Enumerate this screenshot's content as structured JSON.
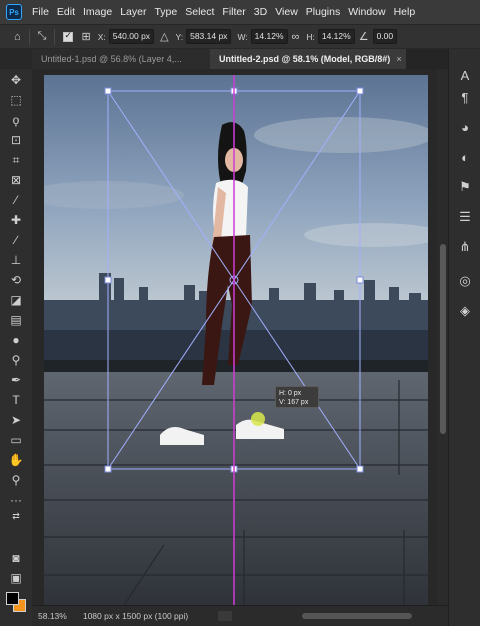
{
  "menu": {
    "logo": "Ps",
    "items": [
      "File",
      "Edit",
      "Image",
      "Layer",
      "Type",
      "Select",
      "Filter",
      "3D",
      "View",
      "Plugins",
      "Window",
      "Help"
    ]
  },
  "options": {
    "x_label": "X:",
    "x_value": "540.00 px",
    "y_label": "Y:",
    "y_value": "583.14 px",
    "w_label": "W:",
    "w_value": "14.12%",
    "h_label": "H:",
    "h_value": "14.12%",
    "angle_value": "0.00"
  },
  "tabs": [
    {
      "label": "Untitled-1.psd @ 56.8% (Layer 4,...",
      "active": false
    },
    {
      "label": "Untitled-2.psd @ 58.1% (Model, RGB/8#)",
      "active": true,
      "close": "×"
    }
  ],
  "tooltip": {
    "line1": "H:    0 px",
    "line2": "V:  167 px"
  },
  "status": {
    "zoom": "58.13%",
    "doc_info": "1080 px x 1500 px (100 ppi)"
  },
  "colors": {
    "foreground": "#000000",
    "background": "#f7941d",
    "guide": "#d03bd6",
    "bbox": "#9aa8ff"
  }
}
